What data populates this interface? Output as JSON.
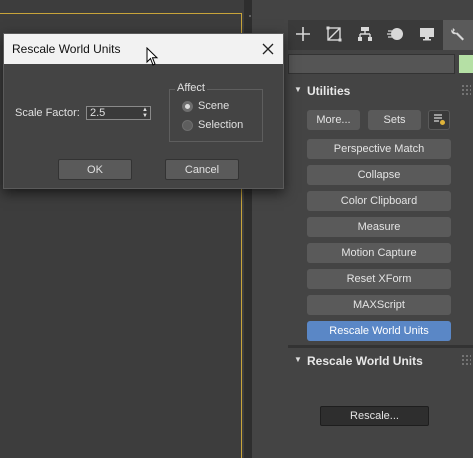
{
  "dialog": {
    "title": "Rescale World Units",
    "scale_factor_label": "Scale Factor:",
    "scale_factor_value": "2.5",
    "affect_label": "Affect",
    "affect_options": [
      {
        "label": "Scene",
        "selected": true
      },
      {
        "label": "Selection",
        "selected": false
      }
    ],
    "ok_label": "OK",
    "cancel_label": "Cancel"
  },
  "command_panel": {
    "tabs": [
      {
        "icon": "create-icon"
      },
      {
        "icon": "modify-icon"
      },
      {
        "icon": "hierarchy-icon"
      },
      {
        "icon": "motion-icon"
      },
      {
        "icon": "display-icon"
      },
      {
        "icon": "utilities-icon",
        "active": true
      }
    ],
    "object_color": "#b5e0a5"
  },
  "utilities": {
    "title": "Utilities",
    "more_label": "More...",
    "sets_label": "Sets",
    "buttons": [
      {
        "label": "Perspective Match",
        "active": false
      },
      {
        "label": "Collapse",
        "active": false
      },
      {
        "label": "Color Clipboard",
        "active": false
      },
      {
        "label": "Measure",
        "active": false
      },
      {
        "label": "Motion Capture",
        "active": false
      },
      {
        "label": "Reset XForm",
        "active": false
      },
      {
        "label": "MAXScript",
        "active": false
      },
      {
        "label": "Rescale World Units",
        "active": true
      }
    ]
  },
  "rescale_rollout": {
    "title": "Rescale World Units",
    "rescale_label": "Rescale..."
  },
  "colors": {
    "accent": "#5a87c6",
    "viewport_border": "#c8a43a"
  }
}
